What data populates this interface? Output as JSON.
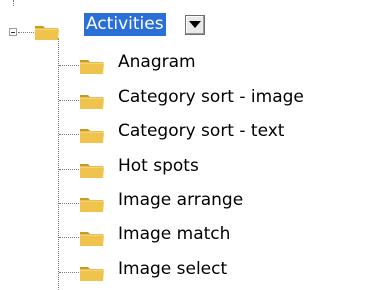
{
  "tree": {
    "root": {
      "label": "Activities",
      "icon": "folder-icon",
      "expanded": true,
      "dropdown_icon": "triangle-down-icon"
    },
    "items": [
      {
        "label": "Anagram",
        "icon": "folder-icon"
      },
      {
        "label": "Category sort - image",
        "icon": "folder-icon"
      },
      {
        "label": "Category sort - text",
        "icon": "folder-icon"
      },
      {
        "label": "Hot spots",
        "icon": "folder-icon"
      },
      {
        "label": "Image arrange",
        "icon": "folder-icon"
      },
      {
        "label": "Image match",
        "icon": "folder-icon"
      },
      {
        "label": "Image select",
        "icon": "folder-icon"
      }
    ]
  },
  "colors": {
    "selection": "#2a6fd6",
    "folder_fill": "#f0c44c",
    "folder_dark": "#c99a1e",
    "tree_line": "#7a7a7a"
  }
}
